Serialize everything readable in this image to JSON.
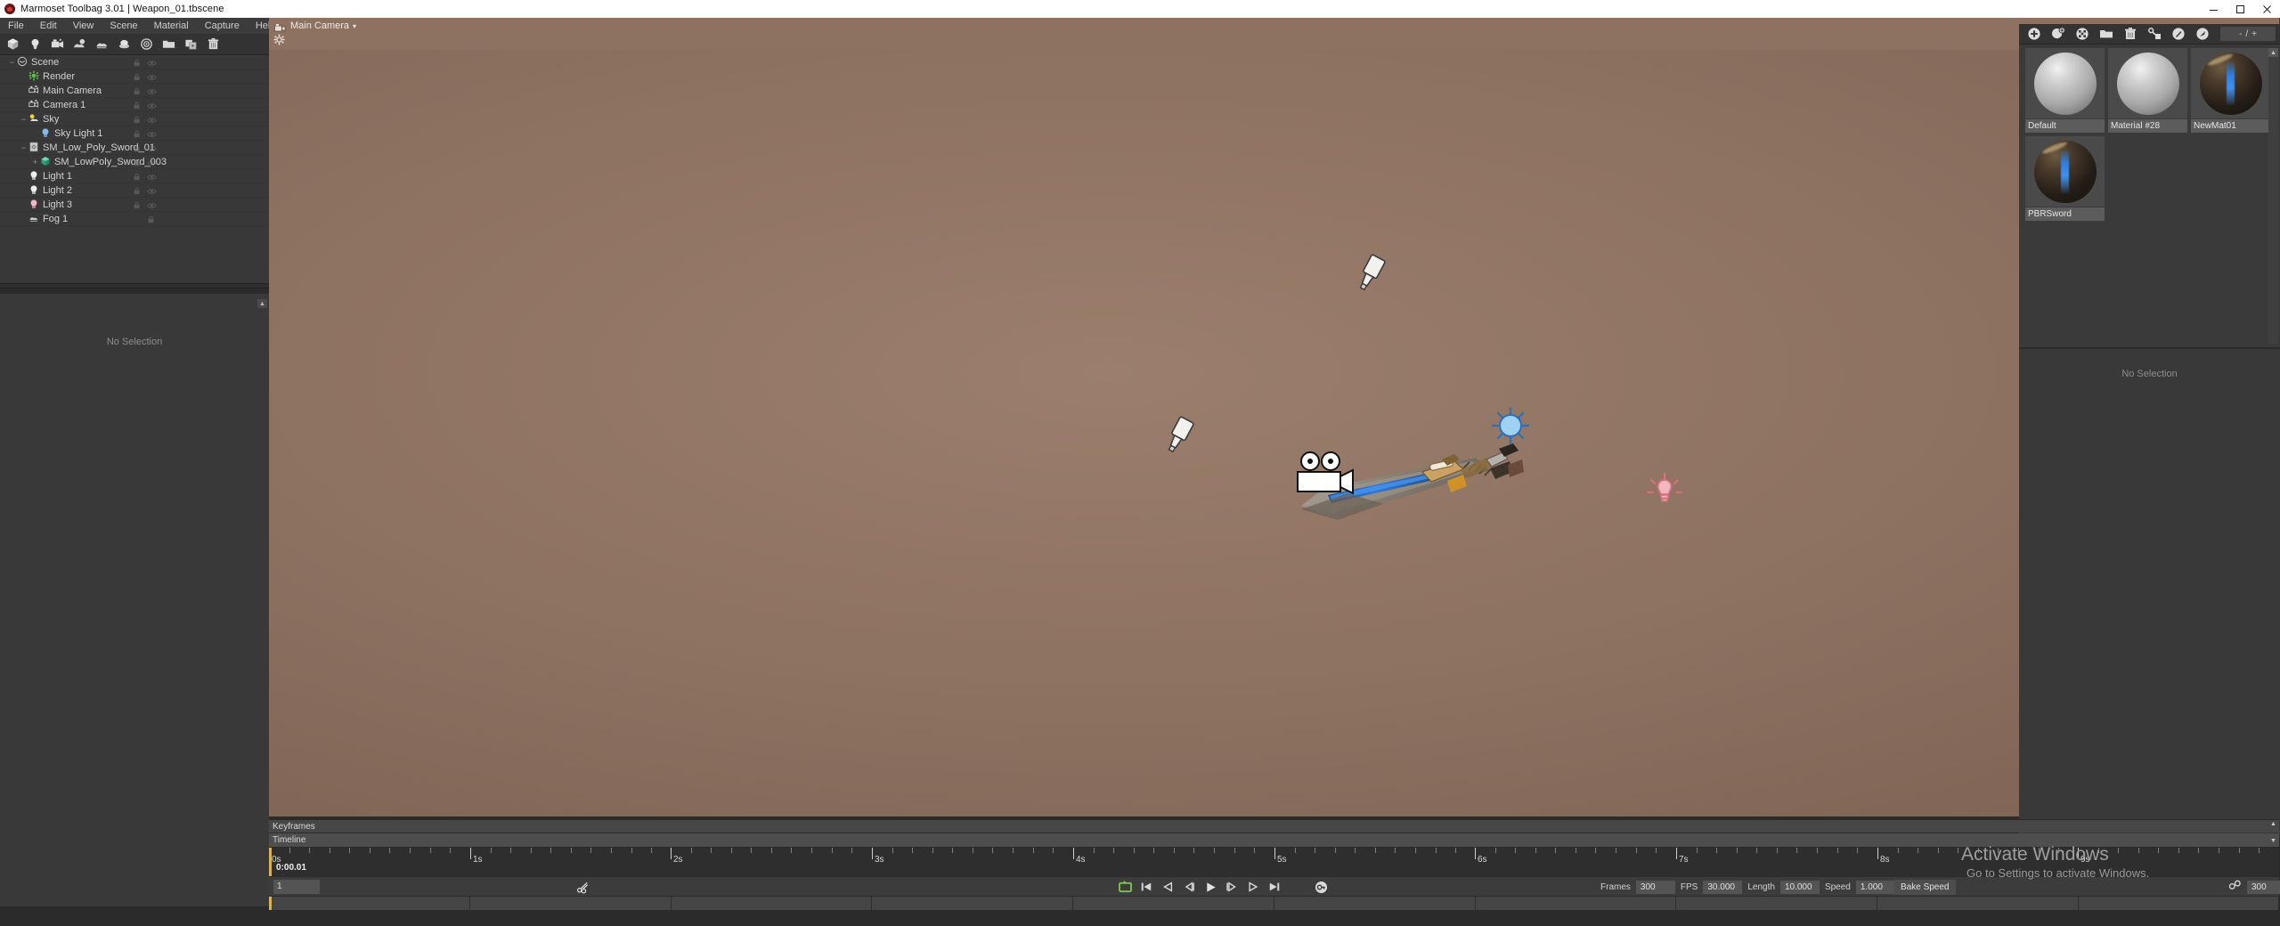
{
  "window": {
    "title": "Marmoset Toolbag 3.01  |  Weapon_01.tbscene",
    "logo": "marmoset-logo",
    "controls": [
      {
        "name": "minimize-button",
        "glyph": "–"
      },
      {
        "name": "maximize-button",
        "glyph": "□"
      },
      {
        "name": "close-button",
        "glyph": "✕"
      }
    ]
  },
  "menubar": {
    "items": [
      {
        "label": "File",
        "name": "menu-file"
      },
      {
        "label": "Edit",
        "name": "menu-edit"
      },
      {
        "label": "View",
        "name": "menu-view"
      },
      {
        "label": "Scene",
        "name": "menu-scene"
      },
      {
        "label": "Material",
        "name": "menu-material"
      },
      {
        "label": "Capture",
        "name": "menu-capture"
      },
      {
        "label": "Help",
        "name": "menu-help"
      }
    ]
  },
  "viewport_tab": {
    "label": "Main Camera",
    "caret": "▾",
    "icon": "camera-icon"
  },
  "left_toolbar": {
    "buttons": [
      {
        "name": "add-mesh-icon",
        "title": "Add Mesh"
      },
      {
        "name": "add-light-icon",
        "title": "Add Light"
      },
      {
        "name": "add-camera-icon",
        "title": "Add Camera"
      },
      {
        "name": "add-sky-icon",
        "title": "Add Sky"
      },
      {
        "name": "add-fog-icon",
        "title": "Add Fog"
      },
      {
        "name": "add-turntable-icon",
        "title": "Add Turntable"
      },
      {
        "name": "add-subdivision-icon",
        "title": "Subdivision"
      },
      {
        "name": "folder-icon",
        "title": "New Folder"
      },
      {
        "name": "duplicate-icon",
        "title": "Duplicate"
      },
      {
        "name": "trash-icon",
        "title": "Delete"
      }
    ]
  },
  "scene_tree": {
    "nodes": [
      {
        "label": "Scene",
        "depth": 0,
        "icon": "scene-icon",
        "expander": "−",
        "toggles": [
          "lock",
          "eye"
        ],
        "name": "tree-item-scene"
      },
      {
        "label": "Render",
        "depth": 1,
        "icon": "render-icon",
        "expander": "",
        "toggles": [
          "lock",
          "eye"
        ],
        "name": "tree-item-render"
      },
      {
        "label": "Main Camera",
        "depth": 1,
        "icon": "camera-icon",
        "expander": "",
        "toggles": [
          "lock",
          "eye"
        ],
        "name": "tree-item-main-camera"
      },
      {
        "label": "Camera 1",
        "depth": 1,
        "icon": "camera-icon",
        "expander": "",
        "toggles": [
          "lock",
          "eye"
        ],
        "name": "tree-item-camera-1"
      },
      {
        "label": "Sky",
        "depth": 1,
        "icon": "sky-icon",
        "expander": "−",
        "toggles": [
          "lock",
          "eye"
        ],
        "name": "tree-item-sky"
      },
      {
        "label": "Sky Light 1",
        "depth": 2,
        "icon": "light-blue-icon",
        "expander": "",
        "toggles": [
          "lock",
          "eye"
        ],
        "name": "tree-item-sky-light-1"
      },
      {
        "label": "SM_Low_Poly_Sword_01",
        "depth": 1,
        "icon": "mesh-file-icon",
        "expander": "−",
        "toggles": [
          "lock",
          "eye"
        ],
        "name": "tree-item-sm-low-poly-sword-01"
      },
      {
        "label": "SM_LowPoly_Sword_003",
        "depth": 2,
        "icon": "mesh-icon",
        "expander": "+",
        "toggles": [
          "lock",
          "eye"
        ],
        "name": "tree-item-sm-lowpoly-sword-003"
      },
      {
        "label": "Light 1",
        "depth": 1,
        "icon": "light-white-icon",
        "expander": "",
        "toggles": [
          "lock",
          "eye"
        ],
        "name": "tree-item-light-1"
      },
      {
        "label": "Light 2",
        "depth": 1,
        "icon": "light-white-icon",
        "expander": "",
        "toggles": [
          "lock",
          "eye"
        ],
        "name": "tree-item-light-2"
      },
      {
        "label": "Light 3",
        "depth": 1,
        "icon": "light-pink-icon",
        "expander": "",
        "toggles": [
          "lock",
          "eye"
        ],
        "name": "tree-item-light-3"
      },
      {
        "label": "Fog 1",
        "depth": 1,
        "icon": "fog-icon",
        "expander": "",
        "toggles": [
          "lock"
        ],
        "name": "tree-item-fog-1"
      }
    ]
  },
  "left_properties": {
    "empty_text": "No Selection"
  },
  "right_toolbar": {
    "buttons": [
      {
        "name": "add-material-icon",
        "title": "New Material"
      },
      {
        "name": "duplicate-material-icon",
        "title": "Duplicate Material"
      },
      {
        "name": "clear-material-icon",
        "title": "Clear Material"
      },
      {
        "name": "material-folder-icon",
        "title": "Load Material"
      },
      {
        "name": "delete-material-icon",
        "title": "Delete Material"
      },
      {
        "name": "assign-material-icon",
        "title": "Assign Material"
      },
      {
        "name": "pick-material-icon",
        "title": "Pick Material"
      },
      {
        "name": "preview-material-icon",
        "title": "Preview"
      }
    ],
    "counter": {
      "minus": "-",
      "sep": "/",
      "plus": "+"
    }
  },
  "materials": {
    "items": [
      {
        "name": "material-default",
        "label": "Default",
        "thumb": "plain-sphere"
      },
      {
        "name": "material-28",
        "label": "Material #28",
        "thumb": "plain-sphere"
      },
      {
        "name": "material-newmat01",
        "label": "NewMat01",
        "thumb": "pbr-sphere"
      },
      {
        "name": "material-pbrsword",
        "label": "PBRSword",
        "thumb": "pbr-sphere"
      }
    ]
  },
  "right_properties": {
    "empty_text": "No Selection"
  },
  "timeline": {
    "keyframes_label": "Keyframes",
    "timeline_label": "Timeline",
    "timecode": "0:00.01",
    "frame_value": "1",
    "tick_labels": [
      "0s",
      "1s",
      "2s",
      "3s",
      "4s",
      "5s",
      "6s",
      "7s",
      "8s",
      "9s"
    ],
    "transport": [
      {
        "name": "loop-button",
        "glyph": "loop"
      },
      {
        "name": "jump-start-button",
        "glyph": "skip-back"
      },
      {
        "name": "prev-keyframe-button",
        "glyph": "prev"
      },
      {
        "name": "step-back-button",
        "glyph": "step-back"
      },
      {
        "name": "play-button",
        "glyph": "play"
      },
      {
        "name": "step-forward-button",
        "glyph": "step-fwd"
      },
      {
        "name": "next-keyframe-button",
        "glyph": "next"
      },
      {
        "name": "jump-end-button",
        "glyph": "skip-fwd"
      },
      {
        "name": "key-button",
        "glyph": "key"
      }
    ],
    "scissors_icon": "scissors-icon",
    "fields": [
      {
        "name": "frames-field",
        "label": "Frames",
        "value": "300"
      },
      {
        "name": "fps-field",
        "label": "FPS",
        "value": "30.000"
      },
      {
        "name": "length-field",
        "label": "Length",
        "value": "10.000"
      },
      {
        "name": "speed-field",
        "label": "Speed",
        "value": "1.000"
      }
    ],
    "bake_speed_label": "Bake Speed",
    "link_icon": "link-icon",
    "link_value": "300"
  },
  "watermark": {
    "title": "Activate Windows",
    "subtitle": "Go to Settings to activate Windows."
  },
  "colors": {
    "viewport_bg": "#8d7161",
    "panel_bg": "#383838",
    "toolbar_bg": "#333333",
    "accent_playhead": "#d7b45a",
    "accent_loop": "#7ec34a"
  }
}
